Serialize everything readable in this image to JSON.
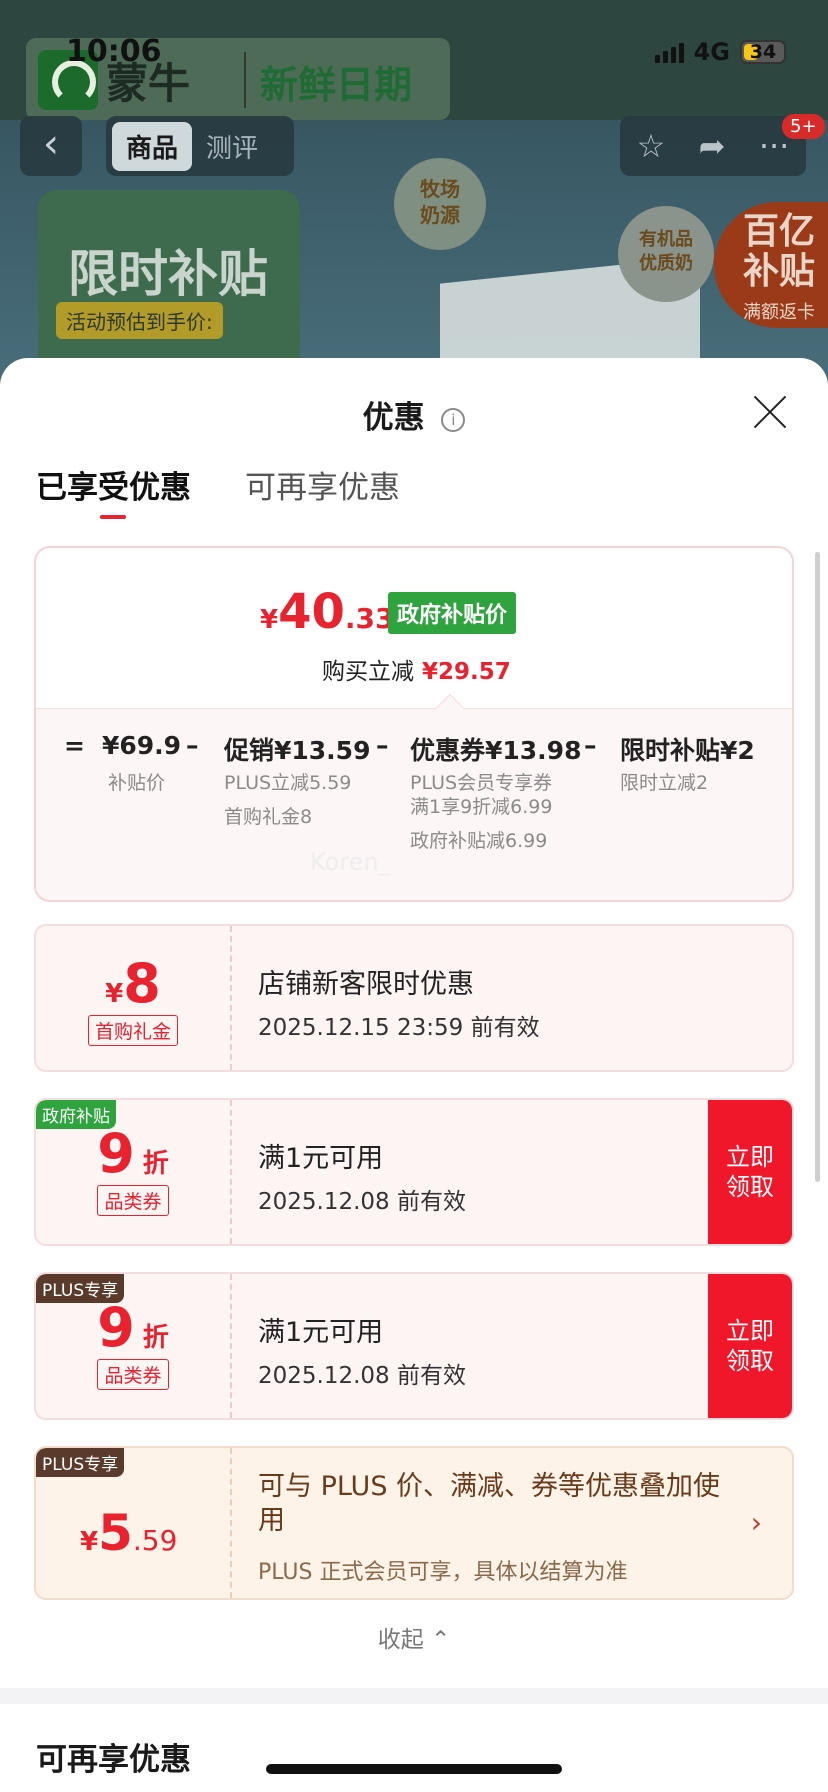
{
  "status_bar": {
    "time": "10:06",
    "network": "4G",
    "battery": "34"
  },
  "product_page": {
    "brand": "蒙牛",
    "brand_tag": "新鲜日期",
    "tabs": [
      "商品",
      "测评"
    ],
    "notification_badge": "5+",
    "promo_title": "限时补贴",
    "promo_sub": "活动预估到手价:",
    "badge_milk": "牧场\n奶源",
    "badge_organic": "有机品\n优质奶",
    "badge_subsidy_big": "百亿\n补贴",
    "badge_subsidy_small": "满额返卡"
  },
  "sheet": {
    "title": "优惠",
    "info_icon": "i",
    "tabs": {
      "enjoyed": "已享受优惠",
      "more": "可再享优惠"
    },
    "summary": {
      "currency": "¥",
      "price_int": "40",
      "price_dec": ".33",
      "gov_tag": "政府补贴价",
      "reduce_label": "购买立减",
      "reduce_amount": "¥29.57",
      "breakdown": {
        "eq": "=",
        "base_value": "¥69.9",
        "base_label": "补贴价",
        "minus": "–",
        "promo_value": "促销¥13.59",
        "promo_sub1": "PLUS立减5.59",
        "promo_sub2": "首购礼金8",
        "coupon_value": "优惠券¥13.98",
        "coupon_sub1": "PLUS会员专享券",
        "coupon_sub2": "满1享9折减6.99",
        "coupon_sub3": "政府补贴减6.99",
        "limited_value": "限时补贴¥2",
        "limited_sub": "限时立减2"
      }
    },
    "watermark": "Koren_",
    "coupons": [
      {
        "amount": "8",
        "currency": "¥",
        "label": "首购礼金",
        "title": "店铺新客限时优惠",
        "date": "2025.12.15 23:59 前有效"
      },
      {
        "corner": "政府补贴",
        "amount": "9",
        "unit": "折",
        "label": "品类券",
        "title": "满1元可用",
        "date": "2025.12.08 前有效",
        "claim": "立即\n领取"
      },
      {
        "corner": "PLUS专享",
        "amount": "9",
        "unit": "折",
        "label": "品类券",
        "title": "满1元可用",
        "date": "2025.12.08 前有效",
        "claim": "立即\n领取"
      }
    ],
    "plus_card": {
      "corner": "PLUS专享",
      "currency": "¥",
      "amount_int": "5",
      "amount_dec": ".59",
      "title": "可与 PLUS 价、满减、券等优惠叠加使用",
      "note": "PLUS 正式会员可享，具体以结算为准",
      "chevron": "›"
    },
    "collapse_label": "收起 ⌃",
    "more_section_title": "可再享优惠"
  }
}
